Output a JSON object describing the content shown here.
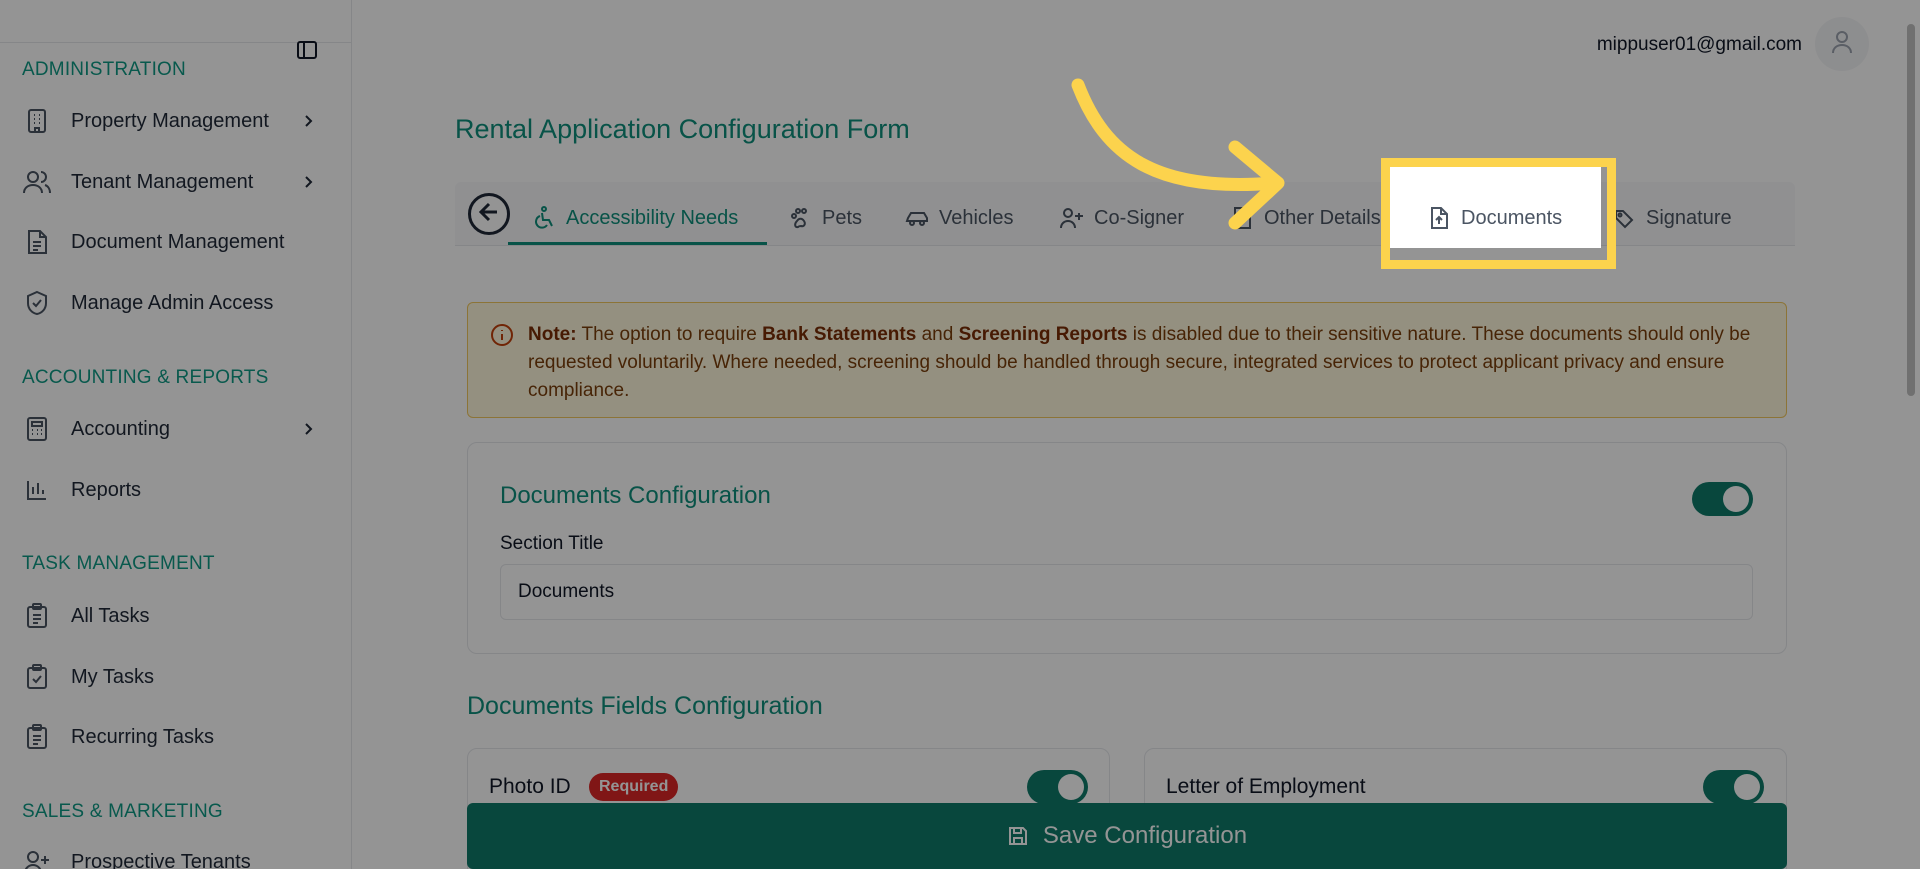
{
  "sidebar": {
    "sections": [
      {
        "label": "ADMINISTRATION"
      },
      {
        "label": "ACCOUNTING & REPORTS"
      },
      {
        "label": "TASK MANAGEMENT"
      },
      {
        "label": "SALES & MARKETING"
      }
    ],
    "items": [
      {
        "label": "Property Management",
        "icon": "building-icon"
      },
      {
        "label": "Tenant Management",
        "icon": "users-icon"
      },
      {
        "label": "Document Management",
        "icon": "document-icon"
      },
      {
        "label": "Manage Admin Access",
        "icon": "shield-check-icon"
      },
      {
        "label": "Accounting",
        "icon": "calculator-icon"
      },
      {
        "label": "Reports",
        "icon": "bar-chart-icon"
      },
      {
        "label": "All Tasks",
        "icon": "clipboard-list-icon"
      },
      {
        "label": "My Tasks",
        "icon": "clipboard-check-icon"
      },
      {
        "label": "Recurring Tasks",
        "icon": "clipboard-list-icon"
      },
      {
        "label": "Prospective Tenants",
        "icon": "user-plus-icon"
      }
    ]
  },
  "header": {
    "user_email": "mippuser01@gmail.com"
  },
  "page": {
    "title": "Rental Application Configuration Form"
  },
  "tabs": [
    {
      "label": "Accessibility Needs",
      "icon": "accessibility-icon",
      "active": true
    },
    {
      "label": "Pets",
      "icon": "paw-icon"
    },
    {
      "label": "Vehicles",
      "icon": "car-icon"
    },
    {
      "label": "Co-Signer",
      "icon": "user-plus-icon"
    },
    {
      "label": "Other Details",
      "icon": "file-icon"
    },
    {
      "label": "Documents",
      "icon": "file-upload-icon",
      "highlighted": true
    },
    {
      "label": "Signature",
      "icon": "signature-icon"
    }
  ],
  "note": {
    "prefix": "Note:",
    "t1": "The option to require",
    "b1": "Bank Statements",
    "t2": "and",
    "b2": "Screening Reports",
    "t3": "is disabled due to their sensitive nature. These documents should only be requested voluntarily. Where needed, screening should be handled through secure, integrated services to protect applicant privacy and ensure compliance."
  },
  "config": {
    "title": "Documents Configuration",
    "enabled": true,
    "section_title_label": "Section Title",
    "section_title_value": "Documents"
  },
  "fields": {
    "title": "Documents Fields Configuration",
    "items": [
      {
        "label": "Photo ID",
        "badge": "Required",
        "enabled": true
      },
      {
        "label": "Letter of Employment",
        "enabled": true
      }
    ]
  },
  "save_button": {
    "label": "Save Configuration"
  },
  "colors": {
    "brand": "#0f8f7c",
    "toggle_on": "#0f7a6a",
    "highlight": "#fcd34d",
    "required_badge": "#dc2626",
    "note_bg": "#fff8dc"
  }
}
